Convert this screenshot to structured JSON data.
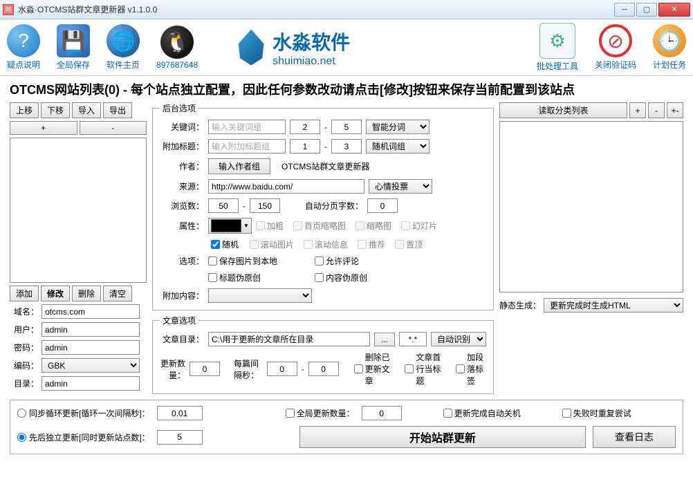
{
  "window": {
    "title": "水淼·OTCMS站群文章更新器 v1.1.0.0",
    "icon": "网"
  },
  "toolbar": {
    "help": "疑点说明",
    "save": "全局保存",
    "home": "软件主页",
    "qq": "897687648",
    "batch": "批处理工具",
    "stop": "关闭验证码",
    "clock": "计划任务"
  },
  "brand": {
    "cn": "水淼软件",
    "en": "shuimiao.net"
  },
  "instruction": "OTCMS网站列表(0) - 每个站点独立配置，因此任何参数改动请点击[修改]按钮来保存当前配置到该站点",
  "left": {
    "up": "上移",
    "down": "下移",
    "imp": "导入",
    "exp": "导出",
    "plus": "+",
    "minus": "-",
    "add": "添加",
    "edit": "修改",
    "del": "删除",
    "clear": "清空",
    "domain_l": "域名：",
    "domain_v": "otcms.com",
    "user_l": "用户：",
    "user_v": "admin",
    "pass_l": "密码：",
    "pass_v": "admin",
    "enc_l": "编码：",
    "enc_v": "GBK",
    "dir_l": "目录：",
    "dir_v": "admin"
  },
  "backstage": {
    "legend": "后台选项",
    "keyword_l": "关键词：",
    "keyword_ph": "输入关键词组",
    "kw_a": "2",
    "kw_b": "5",
    "kw_mode": "智能分词",
    "title_l": "附加标题：",
    "title_ph": "输入附加标题组",
    "t_a": "1",
    "t_b": "3",
    "t_mode": "随机词组",
    "author_l": "作者：",
    "author_btn": "输入作者组",
    "author_v": "OTCMS站群文章更新器",
    "source_l": "来源：",
    "source_v": "http://www.baidu.com/",
    "source_mode": "心情投票",
    "views_l": "浏览数：",
    "v_a": "50",
    "v_b": "150",
    "page_l": "自动分页字数：",
    "page_v": "0",
    "attr_l": "属性：",
    "attr": {
      "bold": "加粗",
      "thumb1": "首页缩略图",
      "thumb2": "缩略图",
      "slide": "幻灯片",
      "rand": "随机",
      "scrollimg": "滚动图片",
      "scrollinfo": "滚动信息",
      "rec": "推荐",
      "top": "置顶"
    },
    "opt_l": "选项：",
    "opt": {
      "saveimg": "保存图片到本地",
      "comment": "允许评论",
      "ftitle": "标题伪原创",
      "fcontent": "内容伪原创"
    },
    "extra_l": "附加内容："
  },
  "right": {
    "read": "读取分类列表",
    "plus": "+",
    "minus": "-",
    "pm": "+-",
    "static_l": "静态生成：",
    "static_v": "更新完成时生成HTML"
  },
  "article": {
    "legend": "文章选项",
    "dir_l": "文章目录：",
    "dir_v": "C:\\用于更新的文章所在目录",
    "dir_btn": "...",
    "ext": "*.*",
    "auto": "自动识别",
    "count_l": "更新数量：",
    "count_v": "0",
    "gap_l": "每篇间隔秒：",
    "gap_a": "0",
    "gap_b": "0",
    "delupd": "删除已更新文章",
    "firstline": "文章首行当标题",
    "para": "加段落标签"
  },
  "bottom": {
    "sync": "同步循环更新[循环一次间隔秒]：",
    "sync_v": "0.01",
    "global_l": "全局更新数量：",
    "global_v": "0",
    "shutdown": "更新完成自动关机",
    "retry": "失败时重复尝试",
    "seq": "先后独立更新[同时更新站点数]：",
    "seq_v": "5",
    "start": "开始站群更新",
    "log": "查看日志"
  }
}
